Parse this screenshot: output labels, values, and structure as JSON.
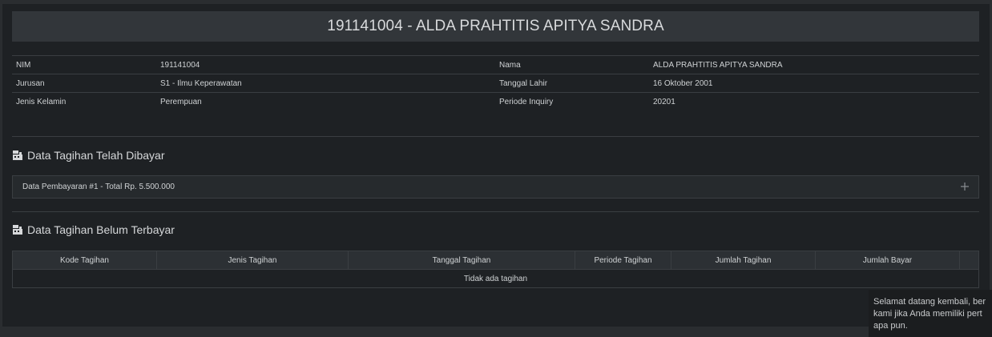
{
  "title": "191141004 - ALDA PRAHTITIS APITYA SANDRA",
  "student": {
    "rows": [
      {
        "label1": "NIM",
        "value1": "191141004",
        "label2": "Nama",
        "value2": "ALDA PRAHTITIS APITYA SANDRA"
      },
      {
        "label1": "Jurusan",
        "value1": "S1 - Ilmu Keperawatan",
        "label2": "Tanggal Lahir",
        "value2": "16 Oktober 2001"
      },
      {
        "label1": "Jenis Kelamin",
        "value1": "Perempuan",
        "label2": "Periode Inquiry",
        "value2": "20201"
      }
    ]
  },
  "paid_section": {
    "title": "Data Tagihan Telah Dibayar",
    "icon": "cash-register-icon",
    "payment_item": "Data Pembayaran #1 - Total Rp. 5.500.000",
    "expand_icon": "plus-icon"
  },
  "unpaid_section": {
    "title": "Data Tagihan Belum Terbayar",
    "icon": "cash-register-icon",
    "columns": [
      "Kode Tagihan",
      "Jenis Tagihan",
      "Tanggal Tagihan",
      "Periode Tagihan",
      "Jumlah Tagihan",
      "Jumlah Bayar"
    ],
    "empty_message": "Tidak ada tagihan"
  },
  "toast": {
    "line1": "Selamat datang kembali, ber",
    "line2": "kami jika Anda memiliki pert",
    "line3": "apa pun."
  },
  "colors": {
    "background": "#1e2124",
    "title_bar": "#32363a",
    "border": "#3a3e42"
  }
}
